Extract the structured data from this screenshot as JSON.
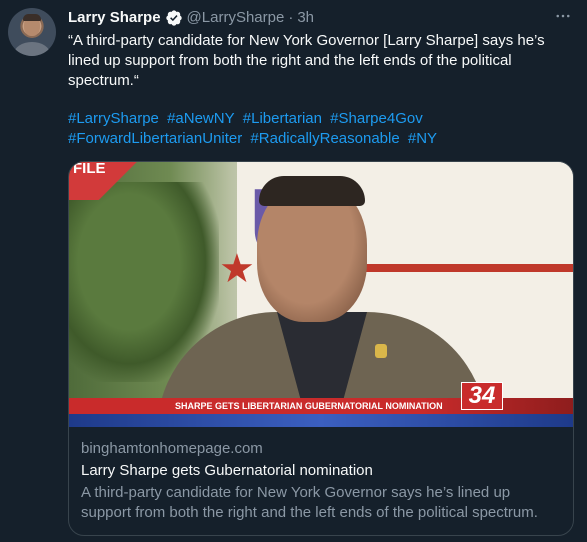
{
  "tweet": {
    "author_name": "Larry Sharpe",
    "handle": "@LarrySharpe",
    "separator": "·",
    "time": "3h",
    "more_icon": "more-horizontal-icon",
    "verified_icon": "verified-badge-icon",
    "text": "“A third-party candidate for New York Governor [Larry Sharpe] says he’s lined up support from both the right and the left ends of the political spectrum.“",
    "hashtags": [
      "#LarrySharpe",
      "#aNewNY",
      "#Libertarian",
      "#Sharpe4Gov",
      "#ForwardLibertarianUniter",
      "#RadicallyReasonable",
      "#NY"
    ]
  },
  "card": {
    "image": {
      "file_tag": "FILE",
      "chyron_text": "SHARPE GETS LIBERTARIAN GUBERNATORIAL NOMINATION",
      "channel_logo": "34"
    },
    "domain": "binghamtonhomepage.com",
    "title": "Larry Sharpe gets Gubernatorial nomination",
    "description": "A third-party candidate for New York Governor says he’s lined up support from both the right and the left ends of the political spectrum."
  },
  "colors": {
    "background": "#15202b",
    "link": "#1d9bf0",
    "muted": "#8b98a5",
    "text": "#f7f9f9",
    "border": "#38444d"
  }
}
